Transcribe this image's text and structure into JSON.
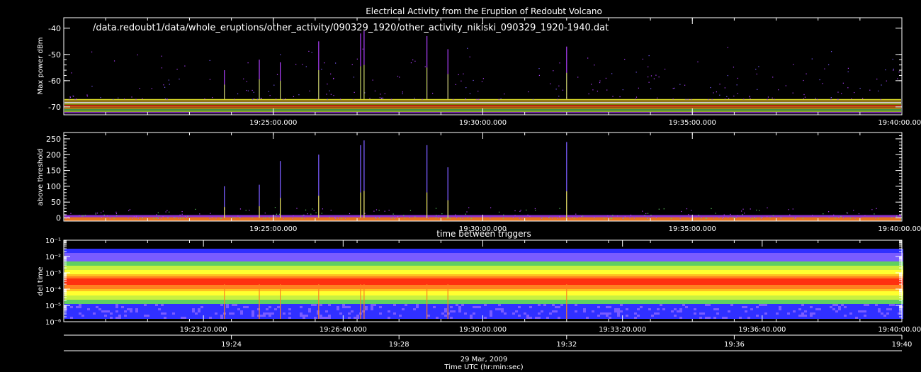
{
  "title": "Electrical Activity from the Eruption of Redoubt Volcano",
  "file_path": "/data.redoubt1/data/whole_eruptions/other_activity/090329_1920/other_activity_nikiski_090329_1920-1940.dat",
  "date_label": "29 Mar, 2009",
  "time_axis_label": "Time UTC (hr:min:sec)",
  "colors": {
    "background": "#000000",
    "axes": "#ffffff",
    "scale": [
      "#3030ff",
      "#7a5cff",
      "#b040ff",
      "#5fd060",
      "#c8f040",
      "#ffff30",
      "#ffc020",
      "#ff8020",
      "#ff3010",
      "#ffffff"
    ]
  },
  "chart_data": [
    {
      "type": "scatter",
      "ylabel": "Max power dBm",
      "ylim": [
        -73,
        -36
      ],
      "yticks": [
        -40,
        -50,
        -60,
        -70
      ],
      "xlim": [
        "19:20:00",
        "19:40:00"
      ],
      "xticks": [
        "19:25:00.000",
        "19:30:00.000",
        "19:35:00.000",
        "19:40:00.000"
      ],
      "baseline_band": [
        -72,
        -67
      ],
      "spikes": [
        {
          "t": "19:23:50",
          "peak": -56
        },
        {
          "t": "19:24:40",
          "peak": -52
        },
        {
          "t": "19:25:10",
          "peak": -53
        },
        {
          "t": "19:26:05",
          "peak": -45
        },
        {
          "t": "19:27:05",
          "peak": -42
        },
        {
          "t": "19:27:10",
          "peak": -41
        },
        {
          "t": "19:28:40",
          "peak": -43
        },
        {
          "t": "19:29:10",
          "peak": -48
        },
        {
          "t": "19:32:00",
          "peak": -47
        }
      ]
    },
    {
      "type": "scatter",
      "ylabel": "above threshold",
      "ylim": [
        -10,
        270
      ],
      "yticks": [
        0,
        50,
        100,
        150,
        200,
        250
      ],
      "xlim": [
        "19:20:00",
        "19:40:00"
      ],
      "xticks": [
        "19:25:00.000",
        "19:30:00.000",
        "19:35:00.000",
        "19:40:00.000"
      ],
      "spikes": [
        {
          "t": "19:23:50",
          "peak": 100
        },
        {
          "t": "19:24:40",
          "peak": 105
        },
        {
          "t": "19:25:10",
          "peak": 180
        },
        {
          "t": "19:26:05",
          "peak": 200
        },
        {
          "t": "19:27:05",
          "peak": 230
        },
        {
          "t": "19:27:10",
          "peak": 245
        },
        {
          "t": "19:28:40",
          "peak": 230
        },
        {
          "t": "19:29:10",
          "peak": 160
        },
        {
          "t": "19:32:00",
          "peak": 240
        }
      ]
    },
    {
      "type": "heatmap",
      "title": "time between triggers",
      "ylabel": "del time",
      "yscale": "log",
      "ylim": [
        1e-06,
        0.1
      ],
      "ytick_labels": [
        "10⁻¹",
        "10⁻²",
        "10⁻³",
        "10⁻⁴",
        "10⁻⁵",
        "10⁻⁶"
      ],
      "xlim": [
        "19:20:00",
        "19:40:00"
      ],
      "xticks": [
        "19:23:20.000",
        "19:26:40.000",
        "19:30:00.000",
        "19:33:20.000",
        "19:36:40.000",
        "19:40:00.000"
      ],
      "xticks_secondary": [
        "19:24",
        "19:28",
        "19:32",
        "19:36",
        "19:40"
      ],
      "density_peak": 0.0003
    }
  ]
}
